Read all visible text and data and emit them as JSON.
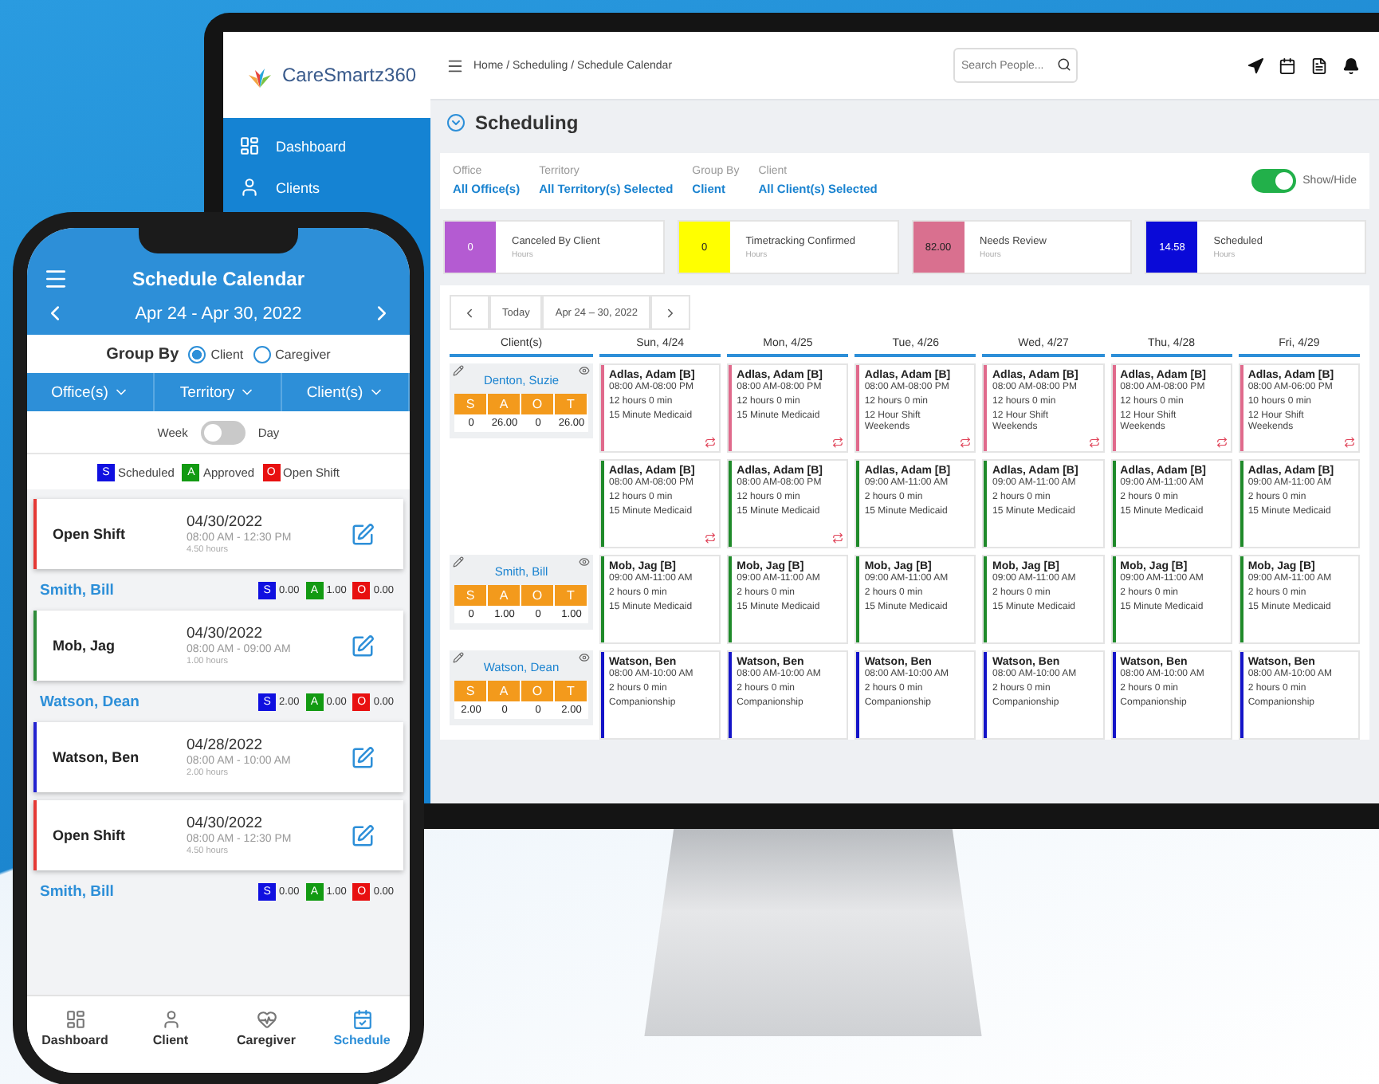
{
  "desktop": {
    "logo": "CareSmartz360",
    "breadcrumb": "Home / Scheduling / Schedule Calendar",
    "search": {
      "placeholder": "Search People..."
    },
    "sidebar": {
      "items": [
        {
          "label": "Dashboard"
        },
        {
          "label": "Clients"
        }
      ]
    },
    "title": "Scheduling",
    "filters": [
      {
        "label": "Office",
        "value": "All Office(s)"
      },
      {
        "label": "Territory",
        "value": "All Territory(s) Selected"
      },
      {
        "label": "Group By",
        "value": "Client"
      },
      {
        "label": "Client",
        "value": "All Client(s) Selected"
      }
    ],
    "toggle": {
      "label": "Show/Hide",
      "on": true
    },
    "summary": [
      {
        "total": "0",
        "status": "Canceled By Client",
        "unit": "Hours",
        "color": "#b45bd2"
      },
      {
        "total": "0",
        "status": "Timetracking Confirmed",
        "unit": "Hours",
        "color": "#ffff00"
      },
      {
        "total": "82.00",
        "status": "Needs Review",
        "unit": "Hours",
        "color": "#d9708f"
      },
      {
        "total": "14.58",
        "status": "Scheduled",
        "unit": "Hours",
        "color": "#0a0ad8"
      }
    ],
    "calendar": {
      "today": "Today",
      "range": "Apr 24 – 30, 2022",
      "columns": [
        "Client(s)",
        "Sun, 4/24",
        "Mon, 4/25",
        "Tue, 4/26",
        "Wed, 4/27",
        "Thu, 4/28",
        "Fri, 4/29"
      ],
      "clients": [
        {
          "name": "Denton, Suzie",
          "letters": [
            "S",
            "A",
            "O",
            "T"
          ],
          "totals": [
            "0",
            "26.00",
            "0",
            "26.00"
          ],
          "lines": [
            [
              {
                "name": "Adlas, Adam [B]",
                "time": "08:00 AM-08:00 PM",
                "duration": "12 hours 0 min",
                "service": "15 Minute Medicaid",
                "color": "#e06a8c",
                "flag": true
              },
              {
                "name": "Adlas, Adam [B]",
                "time": "08:00 AM-08:00 PM",
                "duration": "12 hours 0 min",
                "service": "15 Minute Medicaid",
                "color": "#e06a8c",
                "flag": true
              },
              {
                "name": "Adlas, Adam [B]",
                "time": "08:00 AM-08:00 PM",
                "duration": "12 hours 0 min",
                "service": "12 Hour Shift Weekends",
                "color": "#e06a8c",
                "flag": true
              },
              {
                "name": "Adlas, Adam [B]",
                "time": "08:00 AM-08:00 PM",
                "duration": "12 hours 0 min",
                "service": "12 Hour Shift Weekends",
                "color": "#e06a8c",
                "flag": true
              },
              {
                "name": "Adlas, Adam [B]",
                "time": "08:00 AM-08:00 PM",
                "duration": "12 hours 0 min",
                "service": "12 Hour Shift Weekends",
                "color": "#e06a8c",
                "flag": true
              },
              {
                "name": "Adlas, Adam [B]",
                "time": "08:00 AM-06:00 PM",
                "duration": "10 hours 0 min",
                "service": "12 Hour Shift Weekends",
                "color": "#e06a8c",
                "flag": true
              }
            ],
            [
              {
                "name": "Adlas, Adam [B]",
                "time": "08:00 AM-08:00 PM",
                "duration": "12 hours 0 min",
                "service": "15 Minute Medicaid",
                "color": "#1f8a2a",
                "flag": true
              },
              {
                "name": "Adlas, Adam [B]",
                "time": "08:00 AM-08:00 PM",
                "duration": "12 hours 0 min",
                "service": "15 Minute Medicaid",
                "color": "#1f8a2a",
                "flag": true
              },
              {
                "name": "Adlas, Adam [B]",
                "time": "09:00 AM-11:00 AM",
                "duration": "2 hours 0 min",
                "service": "15 Minute Medicaid",
                "color": "#1f8a2a",
                "flag": false
              },
              {
                "name": "Adlas, Adam [B]",
                "time": "09:00 AM-11:00 AM",
                "duration": "2 hours 0 min",
                "service": "15 Minute Medicaid",
                "color": "#1f8a2a",
                "flag": false
              },
              {
                "name": "Adlas, Adam [B]",
                "time": "09:00 AM-11:00 AM",
                "duration": "2 hours 0 min",
                "service": "15 Minute Medicaid",
                "color": "#1f8a2a",
                "flag": false
              },
              {
                "name": "Adlas, Adam [B]",
                "time": "09:00 AM-11:00 AM",
                "duration": "2 hours 0 min",
                "service": "15 Minute Medicaid",
                "color": "#1f8a2a",
                "flag": false
              }
            ]
          ]
        },
        {
          "name": "Smith, Bill",
          "letters": [
            "S",
            "A",
            "O",
            "T"
          ],
          "totals": [
            "0",
            "1.00",
            "0",
            "1.00"
          ],
          "lines": [
            [
              {
                "name": "Mob, Jag [B]",
                "time": "09:00 AM-11:00 AM",
                "duration": "2 hours 0 min",
                "service": "15 Minute Medicaid",
                "color": "#1f8a2a",
                "flag": false
              },
              {
                "name": "Mob, Jag [B]",
                "time": "09:00 AM-11:00 AM",
                "duration": "2 hours 0 min",
                "service": "15 Minute Medicaid",
                "color": "#1f8a2a",
                "flag": false
              },
              {
                "name": "Mob, Jag [B]",
                "time": "09:00 AM-11:00 AM",
                "duration": "2 hours 0 min",
                "service": "15 Minute Medicaid",
                "color": "#1f8a2a",
                "flag": false
              },
              {
                "name": "Mob, Jag [B]",
                "time": "09:00 AM-11:00 AM",
                "duration": "2 hours 0 min",
                "service": "15 Minute Medicaid",
                "color": "#1f8a2a",
                "flag": false
              },
              {
                "name": "Mob, Jag [B]",
                "time": "09:00 AM-11:00 AM",
                "duration": "2 hours 0 min",
                "service": "15 Minute Medicaid",
                "color": "#1f8a2a",
                "flag": false
              },
              {
                "name": "Mob, Jag [B]",
                "time": "09:00 AM-11:00 AM",
                "duration": "2 hours 0 min",
                "service": "15 Minute Medicaid",
                "color": "#1f8a2a",
                "flag": false
              }
            ]
          ]
        },
        {
          "name": "Watson, Dean",
          "letters": [
            "S",
            "A",
            "O",
            "T"
          ],
          "totals": [
            "2.00",
            "0",
            "0",
            "2.00"
          ],
          "lines": [
            [
              {
                "name": "Watson, Ben",
                "time": "08:00 AM-10:00 AM",
                "duration": "2 hours 0 min",
                "service": "Companionship",
                "color": "#1414c8",
                "flag": false
              },
              {
                "name": "Watson, Ben",
                "time": "08:00 AM-10:00 AM",
                "duration": "2 hours 0 min",
                "service": "Companionship",
                "color": "#1414c8",
                "flag": false
              },
              {
                "name": "Watson, Ben",
                "time": "08:00 AM-10:00 AM",
                "duration": "2 hours 0 min",
                "service": "Companionship",
                "color": "#1414c8",
                "flag": false
              },
              {
                "name": "Watson, Ben",
                "time": "08:00 AM-10:00 AM",
                "duration": "2 hours 0 min",
                "service": "Companionship",
                "color": "#1414c8",
                "flag": false
              },
              {
                "name": "Watson, Ben",
                "time": "08:00 AM-10:00 AM",
                "duration": "2 hours 0 min",
                "service": "Companionship",
                "color": "#1414c8",
                "flag": false
              },
              {
                "name": "Watson, Ben",
                "time": "08:00 AM-10:00 AM",
                "duration": "2 hours 0 min",
                "service": "Companionship",
                "color": "#1414c8",
                "flag": false
              }
            ]
          ]
        }
      ]
    }
  },
  "phone": {
    "title": "Schedule Calendar",
    "range": "Apr 24 - Apr 30, 2022",
    "group_by": {
      "label": "Group By",
      "options": [
        {
          "label": "Client",
          "selected": true
        },
        {
          "label": "Caregiver",
          "selected": false
        }
      ]
    },
    "filters": [
      "Office(s)",
      "Territory",
      "Client(s)"
    ],
    "view_toggle": {
      "left": "Week",
      "right": "Day",
      "on": false
    },
    "legend": [
      {
        "letter": "S",
        "label": "Scheduled",
        "color": "#1010e0"
      },
      {
        "letter": "A",
        "label": "Approved",
        "color": "#129a12"
      },
      {
        "letter": "O",
        "label": "Open Shift",
        "color": "#e81010"
      }
    ],
    "list": [
      {
        "kind": "shift",
        "name": "Open Shift",
        "date": "04/30/2022",
        "time": "08:00 AM - 12:30 PM",
        "hours": "4.50 hours",
        "color": "#e53935"
      },
      {
        "kind": "group",
        "name": "Smith, Bill",
        "stats": [
          {
            "letter": "S",
            "value": "0.00"
          },
          {
            "letter": "A",
            "value": "1.00"
          },
          {
            "letter": "O",
            "value": "0.00"
          }
        ]
      },
      {
        "kind": "shift",
        "name": "Mob, Jag",
        "date": "04/30/2022",
        "time": "08:00 AM - 09:00 AM",
        "hours": "1.00 hours",
        "color": "#2e8b3a"
      },
      {
        "kind": "group",
        "name": "Watson, Dean",
        "stats": [
          {
            "letter": "S",
            "value": "2.00"
          },
          {
            "letter": "A",
            "value": "0.00"
          },
          {
            "letter": "O",
            "value": "0.00"
          }
        ]
      },
      {
        "kind": "shift",
        "name": "Watson, Ben",
        "date": "04/28/2022",
        "time": "08:00 AM - 10:00 AM",
        "hours": "2.00 hours",
        "color": "#2323d0"
      },
      {
        "kind": "shift",
        "name": "Open Shift",
        "date": "04/30/2022",
        "time": "08:00 AM - 12:30 PM",
        "hours": "4.50 hours",
        "color": "#e53935"
      },
      {
        "kind": "group",
        "name": "Smith, Bill",
        "stats": [
          {
            "letter": "S",
            "value": "0.00"
          },
          {
            "letter": "A",
            "value": "1.00"
          },
          {
            "letter": "O",
            "value": "0.00"
          }
        ]
      }
    ],
    "tabs": [
      {
        "label": "Dashboard",
        "selected": false
      },
      {
        "label": "Client",
        "selected": false
      },
      {
        "label": "Caregiver",
        "selected": false
      },
      {
        "label": "Schedule",
        "selected": true
      }
    ]
  }
}
